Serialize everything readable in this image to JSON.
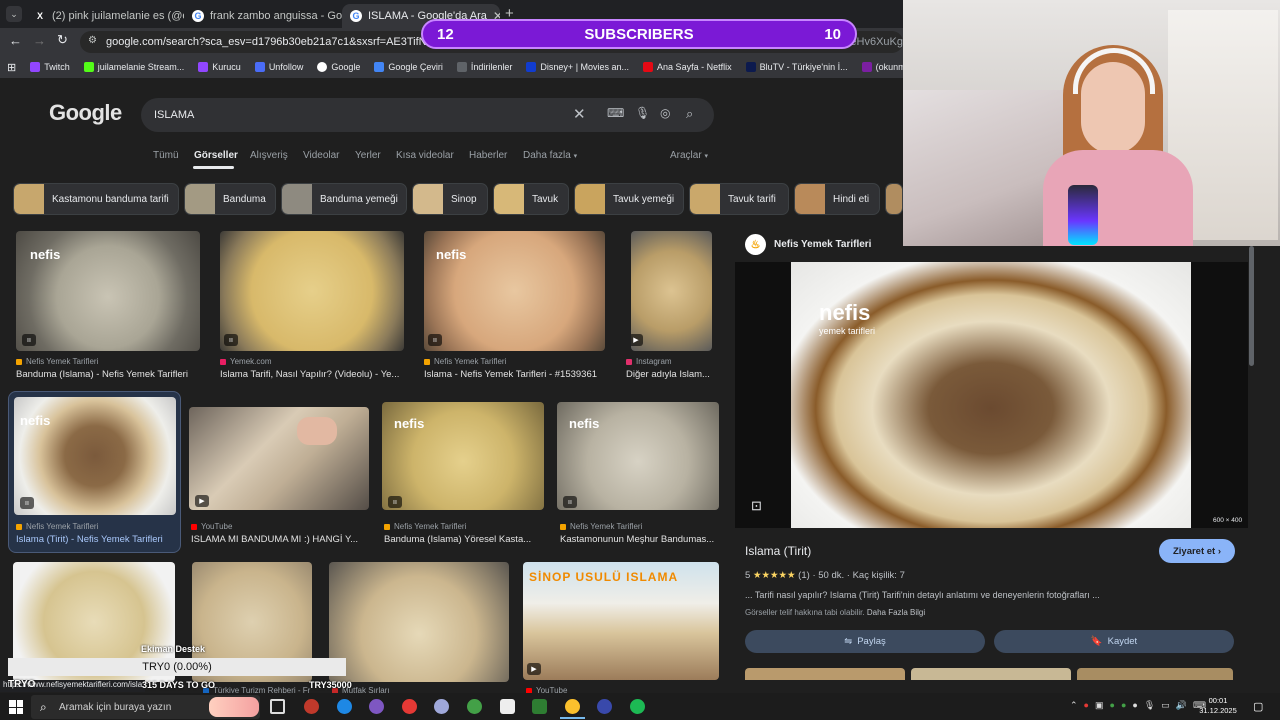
{
  "tabs": [
    {
      "label": "(2) pink juilamelanie es (@emla"
    },
    {
      "label": "frank zambo anguissa - Google"
    },
    {
      "label": "ISLAMA - Google'da Ara"
    }
  ],
  "address": {
    "url": "google.com/search?sca_esv=d1796b30eb21a7c1&sxsrf=AE3TifNcOymLRibU",
    "url_tail": "sjeHv6XuKg"
  },
  "bookmarks": [
    "Twitch",
    "juilamelanie Stream...",
    "Kurucu",
    "Unfollow",
    "Google",
    "Google Çeviri",
    "İndirilenler",
    "Disney+ | Movies an...",
    "Ana Sayfa - Netflix",
    "BluTV - Türkiye'nin İ...",
    "(okunmamış sayısı)..."
  ],
  "overlay": {
    "left_count": "12",
    "label": "SUBSCRIBERS",
    "right_count": "10",
    "ticker": "TRY0 (0.00%)",
    "try_left": "TRYO",
    "days": "315 DAYS TO GO",
    "try_right": "TRY35000",
    "ekiman": "Ekiman Destek"
  },
  "google": {
    "logo": "Google",
    "query": "ISLAMA"
  },
  "nav": [
    "Tümü",
    "Görseller",
    "Alışveriş",
    "Videolar",
    "Yerler",
    "Kısa videolar",
    "Haberler",
    "Daha fazla",
    "Araçlar"
  ],
  "chips": [
    "Kastamonu banduma tarifi",
    "Banduma",
    "Banduma yemeği",
    "Sinop",
    "Tavuk",
    "Tavuk yemeği",
    "Tavuk tarifi",
    "Hindi eti"
  ],
  "results": [
    {
      "source": "Nefis Yemek Tarifleri",
      "title": "Banduma (Islama) - Nefis Yemek Tarifleri"
    },
    {
      "source": "Yemek.com",
      "title": "Islama Tarifi, Nasıl Yapılır? (Videolu) - Ye..."
    },
    {
      "source": "Nefis Yemek Tarifleri",
      "title": "Islama - Nefis Yemek Tarifleri - #1539361"
    },
    {
      "source": "Instagram",
      "title": "Diğer adıyla Islam..."
    },
    {
      "source": "Nefis Yemek Tarifleri",
      "title": "Islama (Tirit) - Nefis Yemek Tarifleri"
    },
    {
      "source": "YouTube",
      "title": "ISLAMA MI BANDUMA MI :) HANGİ Y..."
    },
    {
      "source": "Nefis Yemek Tarifleri",
      "title": "Banduma (Islama) Yöresel Kasta..."
    },
    {
      "source": "Nefis Yemek Tarifleri",
      "title": "Kastamonunun Meşhur Bandumas..."
    },
    {
      "source": "Türkiye Turizm Rehberi - Fr",
      "title": ""
    },
    {
      "source": "Mutfak Sırları",
      "title": ""
    },
    {
      "source": "YouTube",
      "title": ""
    }
  ],
  "sinop_banner": "SİNOP USULÜ ISLAMA",
  "nefis_watermark": "nefis",
  "nefis_sub": "yemek tarifleri",
  "panel": {
    "source": "Nefis Yemek Tarifleri",
    "dims": "600 × 400",
    "title": "Islama (Tirit)",
    "visit": "Ziyaret et",
    "rating": "5",
    "stars": "★★★★★",
    "reviews": "(1)",
    "duration": "50 dk.",
    "servings": "Kaç kişilik: 7",
    "desc": "... Tarifi nasıl yapılır? Islama (Tirit) Tarifi'nin detaylı anlatımı ve deneyenlerin fotoğrafları ...",
    "copyright": "Görseller telif hakkına tabi olabilir.",
    "more": "Daha Fazla Bilgi",
    "share": "Paylaş",
    "save": "Kaydet"
  },
  "status_url": "https://www.nefisyemektarifleri.com/isla",
  "taskbar": {
    "search": "Aramak için buraya yazın",
    "time": "00:01",
    "date": "31.12.2025"
  }
}
